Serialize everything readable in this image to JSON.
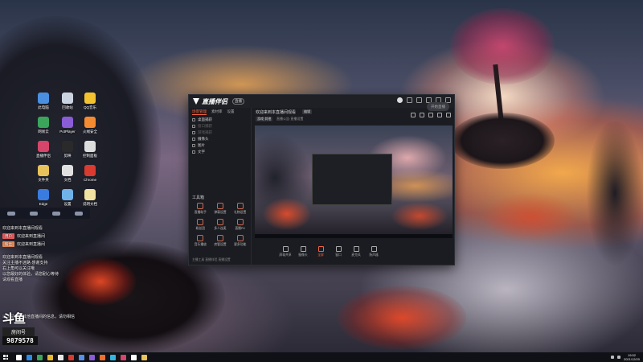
{
  "desktop": {
    "icons": [
      {
        "label": "此电脑",
        "color": "#4a8fe0"
      },
      {
        "label": "回收站",
        "color": "#c9d4e0"
      },
      {
        "label": "QQ音乐",
        "color": "#f2c230"
      },
      {
        "label": "网易云",
        "color": "#3ba55c"
      },
      {
        "label": "PotPlayer",
        "color": "#8a5cd6"
      },
      {
        "label": "火绒安全",
        "color": "#f58b30"
      },
      {
        "label": "直播伴侣",
        "color": "#d6456a"
      },
      {
        "label": "剪映",
        "color": "#2a2a2a"
      },
      {
        "label": "控制面板",
        "color": "#ddd"
      },
      {
        "label": "文件夹",
        "color": "#e8c25a"
      },
      {
        "label": "文档",
        "color": "#e0e0e0"
      },
      {
        "label": "Chrome",
        "color": "#d93b30"
      },
      {
        "label": "Edge",
        "color": "#3a7be0"
      },
      {
        "label": "设置",
        "color": "#6fb2e8"
      },
      {
        "label": "说明文档",
        "color": "#f0e2a0"
      }
    ]
  },
  "chat": {
    "welcome": "欢迎来到本直播间观看",
    "lines": [
      {
        "tag": "用户",
        "tag_color": "#e25a5a",
        "text": "欢迎来到直播间"
      },
      {
        "tag": "粉丝",
        "tag_color": "#e58a5a",
        "text": "欢迎来到直播间"
      }
    ],
    "notice_lines": [
      "欢迎来到本直播间观看",
      "关注主播不迷路 感谢支持",
      "右上角可以关注哦",
      "以您最好的体验，请您耐心等待",
      "请观看直播"
    ],
    "bottom_line": "以下是来自其他直播间的信息，请勿相信",
    "room_logo": "斗鱼",
    "room_label": "房间号",
    "room_number": "9879578"
  },
  "app": {
    "name": "直播伴侣",
    "badge": "直播",
    "live_title": "欢迎来到本直播间观看",
    "edit_title": "编辑",
    "category": "游戏·其他",
    "notice": "直播公告·直播设置",
    "side_tabs": [
      "场景管理",
      "素材库",
      "设置"
    ],
    "scenes": [
      {
        "label": "桌面捕获",
        "dim": false
      },
      {
        "label": "窗口捕获",
        "dim": true
      },
      {
        "label": "游戏捕获",
        "dim": true
      },
      {
        "label": "摄像头",
        "dim": false
      },
      {
        "label": "图片",
        "dim": false
      },
      {
        "label": "文字",
        "dim": false
      }
    ],
    "tools_title": "工具箱",
    "tools": [
      "直播助手",
      "弹幕设置",
      "礼物设置",
      "粉丝团",
      "多人连麦",
      "直播PK",
      "音乐播放",
      "房管设置",
      "更多功能"
    ],
    "footer": "主播工具 直播伴侣 直播设置",
    "controls": [
      {
        "label": "屏幕共享",
        "active": false
      },
      {
        "label": "摄像头",
        "active": false
      },
      {
        "label": "全屏",
        "active": true
      },
      {
        "label": "窗口",
        "active": false
      },
      {
        "label": "麦克风",
        "active": false
      },
      {
        "label": "扬声器",
        "active": false
      }
    ],
    "start_button": "开始直播"
  },
  "taskbar": {
    "apps": [
      "#ffffff",
      "#2d8ae8",
      "#3ba55c",
      "#e8b830",
      "#e8e8e8",
      "#d93b30",
      "#5a8ee8",
      "#8a5cd6",
      "#e87030",
      "#34b4e0",
      "#d6456a",
      "#ffffff",
      "#e8c25a"
    ],
    "time": "19:52",
    "date": "2021/12/20"
  }
}
